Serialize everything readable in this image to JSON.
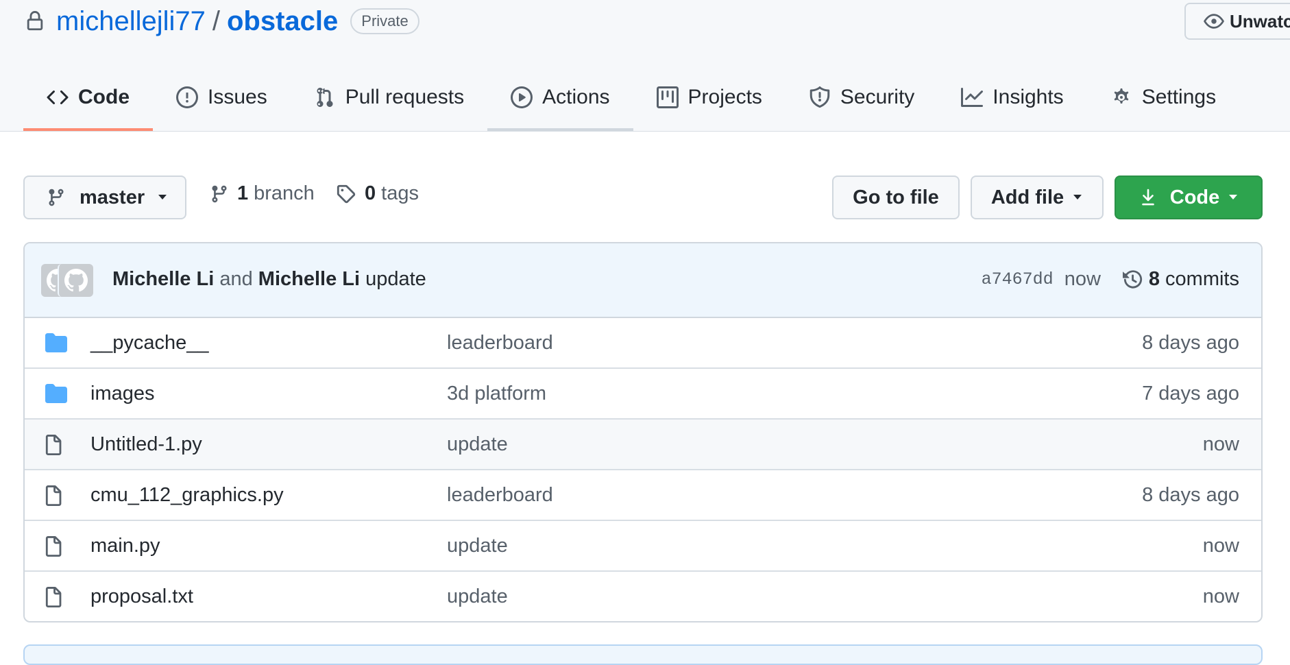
{
  "repo": {
    "owner": "michellejli77",
    "separator": "/",
    "name": "obstacle",
    "visibility": "Private",
    "watch_label": "Unwatch"
  },
  "tabs": [
    {
      "label": "Code",
      "icon": "code-icon",
      "active": true
    },
    {
      "label": "Issues",
      "icon": "issue-icon"
    },
    {
      "label": "Pull requests",
      "icon": "pull-request-icon"
    },
    {
      "label": "Actions",
      "icon": "play-icon"
    },
    {
      "label": "Projects",
      "icon": "project-icon"
    },
    {
      "label": "Security",
      "icon": "shield-icon"
    },
    {
      "label": "Insights",
      "icon": "graph-icon"
    },
    {
      "label": "Settings",
      "icon": "gear-icon"
    }
  ],
  "toolbar": {
    "branch": "master",
    "branch_count": "1",
    "branch_label": "branch",
    "tag_count": "0",
    "tag_label": "tags",
    "go_to_file": "Go to file",
    "add_file": "Add file",
    "code": "Code"
  },
  "latest_commit": {
    "author1": "Michelle Li",
    "joiner": "and",
    "author2": "Michelle Li",
    "message": "update",
    "sha": "a7467dd",
    "time": "now",
    "commit_count": "8",
    "commits_label": "commits"
  },
  "files": [
    {
      "type": "folder",
      "name": "__pycache__",
      "message": "leaderboard",
      "age": "8 days ago"
    },
    {
      "type": "folder",
      "name": "images",
      "message": "3d platform",
      "age": "7 days ago"
    },
    {
      "type": "file",
      "name": "Untitled-1.py",
      "message": "update",
      "age": "now",
      "highlighted": true
    },
    {
      "type": "file",
      "name": "cmu_112_graphics.py",
      "message": "leaderboard",
      "age": "8 days ago"
    },
    {
      "type": "file",
      "name": "main.py",
      "message": "update",
      "age": "now"
    },
    {
      "type": "file",
      "name": "proposal.txt",
      "message": "update",
      "age": "now"
    }
  ],
  "colors": {
    "link": "#0969da",
    "active_tab_underline": "#fd8c73",
    "code_button": "#2da44e",
    "folder": "#54aeff"
  }
}
